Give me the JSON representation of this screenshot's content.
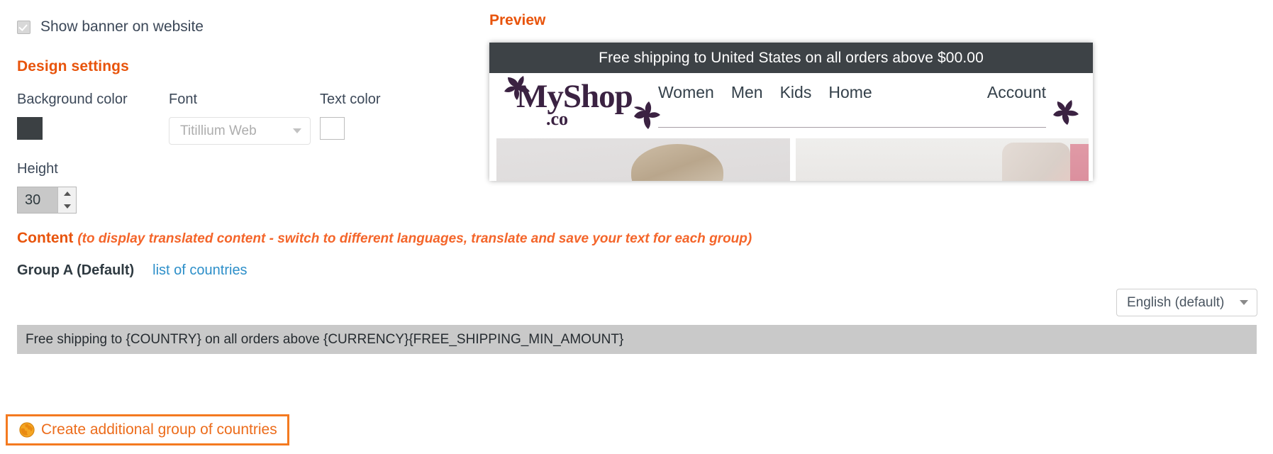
{
  "checkbox": {
    "label": "Show banner on website",
    "checked": true
  },
  "design_settings": {
    "title": "Design settings",
    "background_color": {
      "label": "Background color",
      "value": "#3b4043"
    },
    "font": {
      "label": "Font",
      "value": "Titillium Web",
      "placeholder": "Titillium Web"
    },
    "text_color": {
      "label": "Text color",
      "value": "#ffffff"
    },
    "height": {
      "label": "Height",
      "value": "30"
    }
  },
  "content": {
    "title": "Content",
    "note": "(to display translated content - switch to different languages, translate and save your text for each group)",
    "group_name": "Group A (Default)",
    "countries_link": "list of countries",
    "language_select": "English (default)",
    "text_value": "Free shipping to {COUNTRY} on all orders above {CURRENCY}{FREE_SHIPPING_MIN_AMOUNT}",
    "create_group_button": "Create additional group of countries"
  },
  "preview": {
    "title": "Preview",
    "banner_text": "Free shipping to United States on all orders above $00.00",
    "logo": {
      "main": "MyShop",
      "sub": ".co"
    },
    "nav": [
      "Women",
      "Men",
      "Kids",
      "Home"
    ],
    "account": "Account"
  },
  "colors": {
    "accent_orange": "#e8540c",
    "link_blue": "#2d8fc9",
    "banner_dark": "#3d4246",
    "logo_purple": "#3b2242",
    "button_border": "#f47a20"
  }
}
